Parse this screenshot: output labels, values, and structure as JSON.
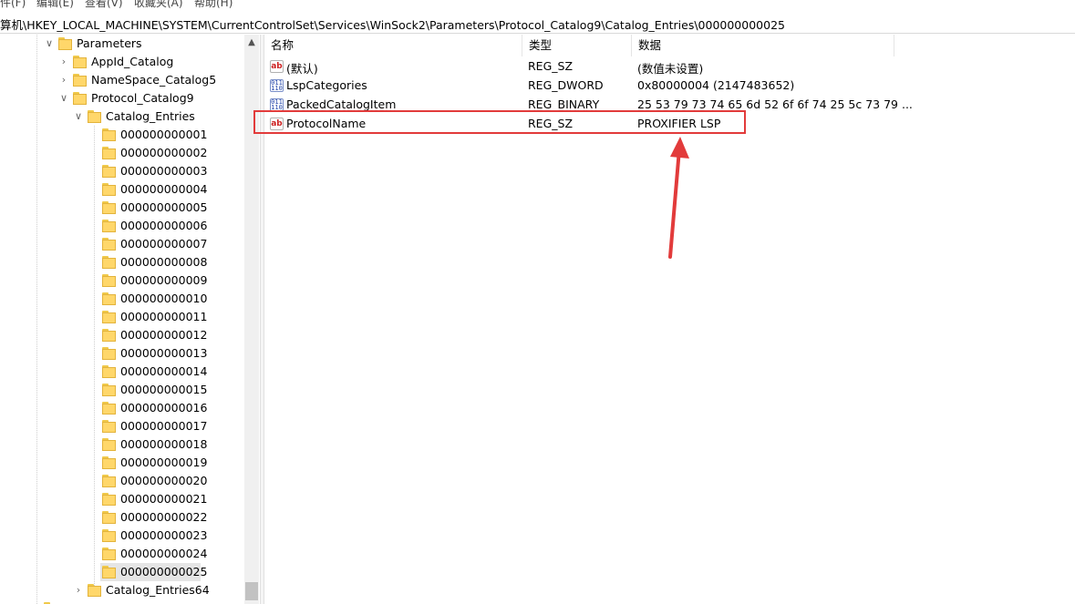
{
  "menu": [
    "件(F)",
    "编辑(E)",
    "查看(V)",
    "收藏夹(A)",
    "帮助(H)"
  ],
  "address": "算机\\HKEY_LOCAL_MACHINE\\SYSTEM\\CurrentControlSet\\Services\\WinSock2\\Parameters\\Protocol_Catalog9\\Catalog_Entries\\000000000025",
  "tree": {
    "parameters": "Parameters",
    "appid": "AppId_Catalog",
    "namespace": "NameSpace_Catalog5",
    "protocol": "Protocol_Catalog9",
    "catalog_entries": "Catalog_Entries",
    "entries": [
      "000000000001",
      "000000000002",
      "000000000003",
      "000000000004",
      "000000000005",
      "000000000006",
      "000000000007",
      "000000000008",
      "000000000009",
      "000000000010",
      "000000000011",
      "000000000012",
      "000000000013",
      "000000000014",
      "000000000015",
      "000000000016",
      "000000000017",
      "000000000018",
      "000000000019",
      "000000000020",
      "000000000021",
      "000000000022",
      "000000000023",
      "000000000024",
      "000000000025"
    ],
    "catalog_entries64": "Catalog_Entries64"
  },
  "columns": {
    "name": "名称",
    "type": "类型",
    "data": "数据"
  },
  "values": [
    {
      "name": "(默认)",
      "type": "REG_SZ",
      "data": "(数值未设置)",
      "icon": "string-value-icon"
    },
    {
      "name": "LspCategories",
      "type": "REG_DWORD",
      "data": "0x80000004 (2147483652)",
      "icon": "binary-value-icon"
    },
    {
      "name": "PackedCatalogItem",
      "type": "REG_BINARY",
      "data": "25 53 79 73 74 65 6d 52 6f 6f 74 25 5c 73 79 ...",
      "icon": "binary-value-icon"
    },
    {
      "name": "ProtocolName",
      "type": "REG_SZ",
      "data": "PROXIFIER LSP",
      "icon": "string-value-icon"
    }
  ],
  "annotation_color": "#e23b3b"
}
